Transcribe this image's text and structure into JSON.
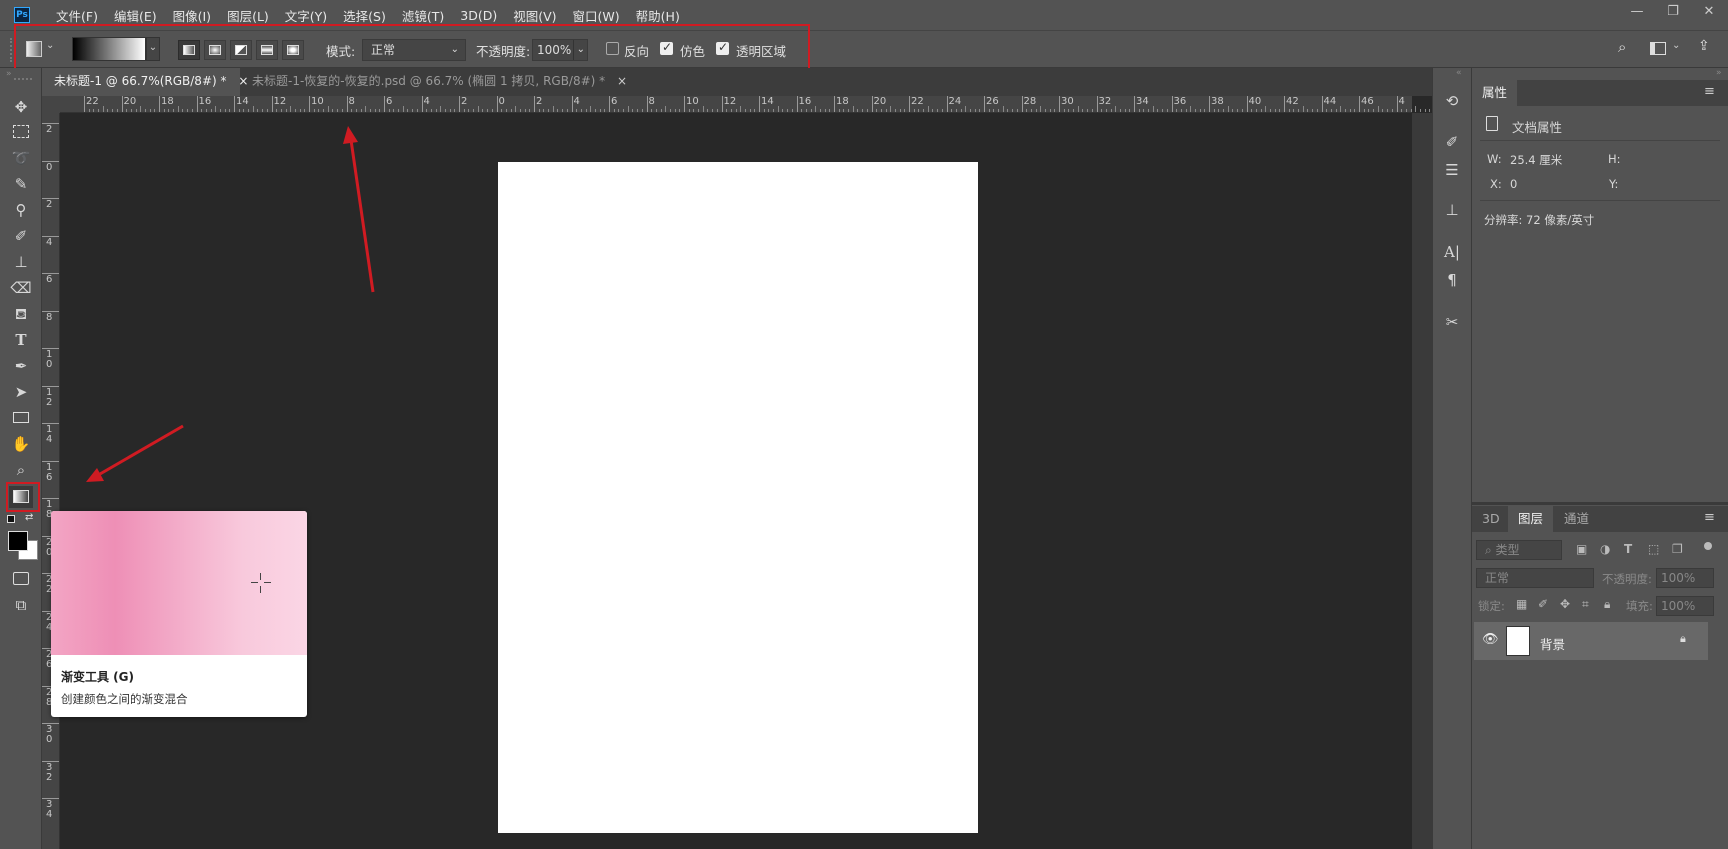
{
  "app": {
    "logo": "Ps"
  },
  "menu": [
    "文件(F)",
    "编辑(E)",
    "图像(I)",
    "图层(L)",
    "文字(Y)",
    "选择(S)",
    "滤镜(T)",
    "3D(D)",
    "视图(V)",
    "窗口(W)",
    "帮助(H)"
  ],
  "window_controls": {
    "minimize": "—",
    "restore": "❐",
    "close": "✕"
  },
  "options": {
    "mode_label": "模式:",
    "mode_value": "正常",
    "opacity_label": "不透明度:",
    "opacity_value": "100%",
    "reverse_label": "反向",
    "reverse_checked": false,
    "dither_label": "仿色",
    "dither_checked": true,
    "transparency_label": "透明区域",
    "transparency_checked": true
  },
  "tabs": [
    {
      "label": "未标题-1 @ 66.7%(RGB/8#) *",
      "close": "×",
      "active": true
    },
    {
      "label": "未标题-1-恢复的-恢复的.psd @ 66.7% (椭圆 1 拷贝, RGB/8#) *",
      "close": "×",
      "active": false
    }
  ],
  "ruler": {
    "horizontal": [
      "22",
      "20",
      "18",
      "16",
      "14",
      "12",
      "10",
      "8",
      "6",
      "4",
      "2",
      "0",
      "2",
      "4",
      "6",
      "8",
      "10",
      "12",
      "14",
      "16",
      "18",
      "20",
      "22",
      "24",
      "26",
      "28",
      "30",
      "32",
      "34",
      "36",
      "38",
      "40",
      "42",
      "44",
      "46",
      "4"
    ],
    "vertical": [
      "2",
      "0",
      "2",
      "4",
      "6",
      "8",
      "1\n0",
      "1\n2",
      "1\n4",
      "1\n6",
      "1\n8",
      "2\n0",
      "2\n2",
      "2\n4",
      "2\n6",
      "2\n8",
      "3\n0",
      "3\n2",
      "3\n4"
    ]
  },
  "tooltip": {
    "title": "渐变工具 (G)",
    "description": "创建颜色之间的渐变混合"
  },
  "properties": {
    "tab": "属性",
    "doc_label": "文档属性",
    "w_label": "W:",
    "w_value": "25.4 厘米",
    "h_label": "H:",
    "x_label": "X:",
    "x_value": "0",
    "y_label": "Y:",
    "resolution": "分辨率: 72 像素/英寸"
  },
  "layers_panel": {
    "tabs": [
      "3D",
      "图层",
      "通道"
    ],
    "active_tab": "图层",
    "filter_placeholder": "类型",
    "blend_mode": "正常",
    "opacity_label": "不透明度:",
    "opacity_value": "100%",
    "lock_label": "锁定:",
    "fill_label": "填充:",
    "fill_value": "100%",
    "layer_name": "背景"
  },
  "colors": {
    "ui_bg": "#535353",
    "workspace": "#282828",
    "annotation_red": "#d01b22",
    "gradient_pink": "#ee8fb6"
  }
}
